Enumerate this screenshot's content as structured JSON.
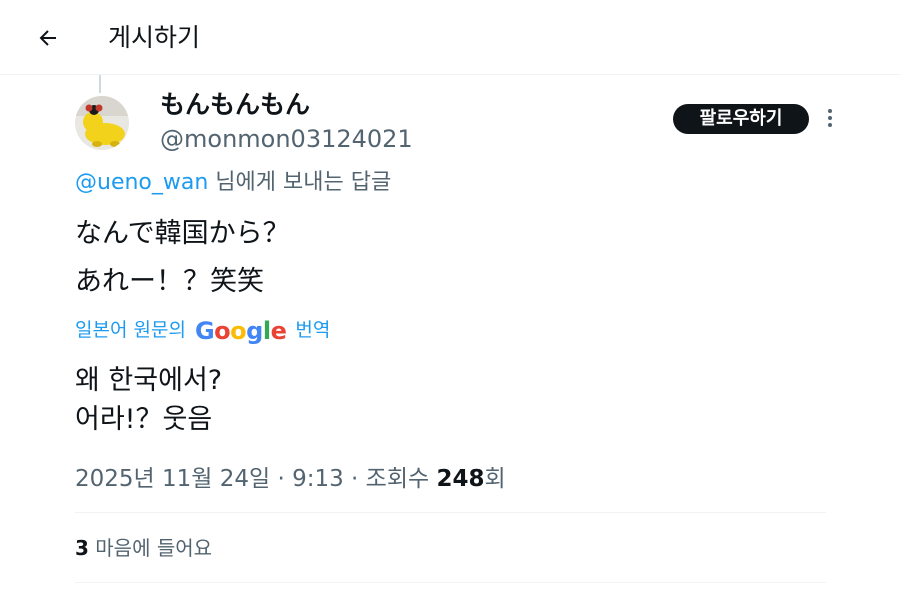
{
  "header": {
    "title": "게시하기",
    "back_icon": "arrow-left-icon"
  },
  "author": {
    "display_name": "もんもんもん",
    "handle": "@monmon03124021",
    "avatar_icon": "yellow-plush-avatar",
    "follow_label": "팔로우하기",
    "more_icon": "more-vertical-icon"
  },
  "reply": {
    "mention": "@ueno_wan",
    "suffix": " 님에게 보내는 답글"
  },
  "tweet": {
    "lines": [
      "なんで韓国から？",
      "あれー！？笑笑"
    ]
  },
  "translation": {
    "prefix": "일본어 원문의",
    "google": "Google",
    "suffix": "번역",
    "lines": [
      "왜 한국에서?",
      "어라!？웃음"
    ]
  },
  "meta": {
    "date": "2025년 11월 24일 · 9:13 · 조회수 ",
    "views": "248",
    "views_suffix": "회"
  },
  "stats": {
    "likes": "3",
    "likes_label": " 마음에 들어요"
  },
  "colors": {
    "text": "#0f1419",
    "muted": "#536471",
    "link": "#1d9bf0",
    "divider": "#eff3f4"
  }
}
